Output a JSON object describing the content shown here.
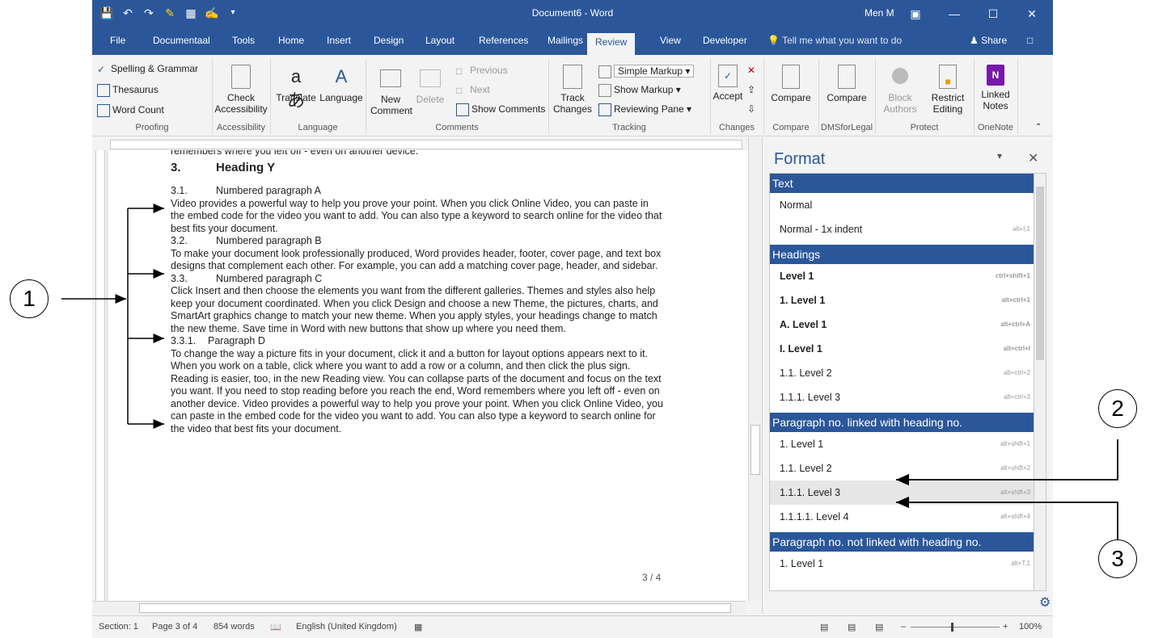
{
  "title_bar": {
    "document_title": "Document6 - Word",
    "user": "Men M",
    "icons": [
      "save-icon",
      "undo-icon",
      "redo-icon",
      "highlight-icon",
      "table-icon",
      "format-painter-icon",
      "customize-icon"
    ]
  },
  "tabs": [
    {
      "label": "File"
    },
    {
      "label": "Documentaal"
    },
    {
      "label": "Tools"
    },
    {
      "label": "Home"
    },
    {
      "label": "Insert"
    },
    {
      "label": "Design"
    },
    {
      "label": "Layout"
    },
    {
      "label": "References"
    },
    {
      "label": "Mailings"
    },
    {
      "label": "Review",
      "active": true
    },
    {
      "label": "View"
    },
    {
      "label": "Developer"
    }
  ],
  "tell_me": "Tell me what you want to do",
  "share": "Share",
  "ribbon": {
    "proofing": {
      "spelling": "Spelling & Grammar",
      "thesaurus": "Thesaurus",
      "word_count": "Word Count",
      "label": "Proofing"
    },
    "accessibility": {
      "check": "Check",
      "check2": "Accessibility",
      "label": "Accessibility"
    },
    "language": {
      "translate": "Translate",
      "language": "Language",
      "label": "Language"
    },
    "comments": {
      "new": "New",
      "new2": "Comment",
      "delete": "Delete",
      "previous": "Previous",
      "next": "Next",
      "show": "Show Comments",
      "label": "Comments"
    },
    "tracking": {
      "track": "Track",
      "track2": "Changes",
      "markup": "Simple Markup",
      "show_markup": "Show Markup",
      "reviewing": "Reviewing Pane",
      "label": "Tracking"
    },
    "changes": {
      "accept": "Accept",
      "label": "Changes"
    },
    "compare": {
      "compare": "Compare",
      "label": "Compare"
    },
    "dms": {
      "compare": "Compare",
      "label": "DMSforLegal"
    },
    "protect": {
      "block": "Block",
      "block2": "Authors",
      "restrict": "Restrict",
      "restrict2": "Editing",
      "label": "Protect"
    },
    "onenote": {
      "linked": "Linked",
      "linked2": "Notes",
      "label": "OneNote"
    }
  },
  "document": {
    "top_line": "remembers where you left off - even on another device.",
    "heading_num": "3.",
    "heading": "Heading Y",
    "para_a_num": "3.1.",
    "para_a_title": "Numbered paragraph A",
    "para_a_text": "Video provides a powerful way to help you prove your point. When you click Online Video, you can paste in the embed code for the video you want to add. You can also type a keyword to search online for the video that best fits your document.",
    "para_b_num": "3.2.",
    "para_b_title": "Numbered paragraph B",
    "para_b_text": "To make your document look professionally produced, Word provides header, footer, cover page, and text box designs that complement each other. For example, you can add a matching cover page, header, and sidebar.",
    "para_c_num": "3.3.",
    "para_c_title": "Numbered paragraph C",
    "para_c_text": "Click Insert and then choose the elements you want from the different galleries. Themes and styles also help keep your document coordinated. When you click Design and choose a new Theme, the pictures, charts, and SmartArt graphics change to match your new theme. When you apply styles, your headings change to match the new theme. Save time in Word with new buttons that show up where you need them.",
    "para_d_num": "3.3.1.",
    "para_d_title": "Paragraph D",
    "para_d_text": "To change the way a picture fits in your document, click it and a button for layout options appears next to it. When you work on a table, click where you want to add a row or a column, and then click the plus sign. Reading is easier, too, in the new Reading view. You can collapse parts of the document and focus on the text you want. If you need to stop reading before you reach the end, Word remembers where you left off - even on another device. Video provides a powerful way to help you prove your point. When you click Online Video, you can paste in the embed code for the video you want to add. You can also type a keyword to search online for the video that best fits your document.",
    "page_number": "3 / 4"
  },
  "format_pane": {
    "title": "Format",
    "sections": [
      {
        "title": "Text",
        "items": [
          {
            "label": "Normal",
            "shortcut": ""
          },
          {
            "label": "Normal - 1x indent",
            "shortcut": "alt+I,1"
          }
        ]
      },
      {
        "title": "Headings",
        "items": [
          {
            "label": "Level 1",
            "shortcut": "ctrl+shift+1",
            "bold": true
          },
          {
            "label": "1.  Level 1",
            "shortcut": "alt+ctrl+1",
            "bold": true
          },
          {
            "label": "A.  Level 1",
            "shortcut": "alt+ctrl+A",
            "bold": true
          },
          {
            "label": "I.  Level 1",
            "shortcut": "alt+ctrl+I",
            "bold": true
          },
          {
            "label": "1.1.  Level 2",
            "shortcut": "alt+ctrl+2"
          },
          {
            "label": "1.1.1.  Level 3",
            "shortcut": "alt+ctrl+3"
          }
        ]
      },
      {
        "title": "Paragraph no. linked with heading no.",
        "items": [
          {
            "label": "1.  Level 1",
            "shortcut": "alt+shift+1"
          },
          {
            "label": "1.1.  Level 2",
            "shortcut": "alt+shift+2"
          },
          {
            "label": "1.1.1.  Level 3",
            "shortcut": "alt+shift+3",
            "selected": true
          },
          {
            "label": "1.1.1.1.  Level 4",
            "shortcut": "alt+shift+4"
          }
        ]
      },
      {
        "title": "Paragraph no. not linked with heading no.",
        "items": [
          {
            "label": "1.  Level 1",
            "shortcut": "alt+T,1"
          }
        ]
      }
    ]
  },
  "status_bar": {
    "section": "Section: 1",
    "page": "Page 3 of 4",
    "words": "854 words",
    "language": "English (United Kingdom)",
    "zoom": "100%"
  },
  "callouts": {
    "one": "1",
    "two": "2",
    "three": "3"
  },
  "colors": {
    "accent": "#2b579a",
    "ribbon_bg": "#f3f3f3"
  }
}
